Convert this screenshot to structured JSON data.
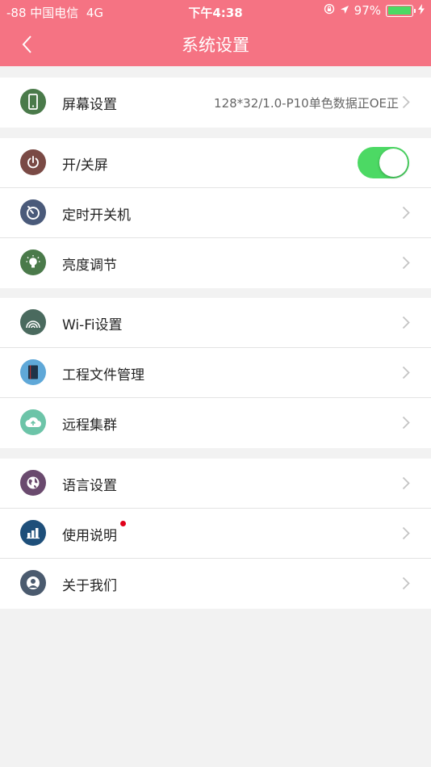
{
  "status_bar": {
    "carrier": "-88 中国电信",
    "network": "4G",
    "time": "下午4:38",
    "battery_percent": "97%",
    "battery_level": 0.97
  },
  "nav": {
    "title": "系统设置"
  },
  "colors": {
    "header": "#f57383",
    "toggle_on": "#4cd964"
  },
  "groups": [
    {
      "rows": [
        {
          "label": "屏幕设置",
          "value": "128*32/1.0-P10单色数据正OE正",
          "icon": "phone-icon",
          "icon_color": "#4a7a4a"
        }
      ]
    },
    {
      "rows": [
        {
          "label": "开/关屏",
          "toggle_on": true,
          "icon": "power-icon",
          "icon_color": "#7a4a45"
        },
        {
          "label": "定时开关机",
          "icon": "timer-icon",
          "icon_color": "#4a5a7a"
        },
        {
          "label": "亮度调节",
          "icon": "bulb-icon",
          "icon_color": "#4a7a4a"
        }
      ]
    },
    {
      "rows": [
        {
          "label": "Wi-Fi设置",
          "icon": "wifi-icon",
          "icon_color": "#4a6a5e"
        },
        {
          "label": "工程文件管理",
          "icon": "notebook-icon",
          "icon_color": "#5fa8d8"
        },
        {
          "label": "远程集群",
          "icon": "cloud-upload-icon",
          "icon_color": "#6cc4a8"
        }
      ]
    },
    {
      "rows": [
        {
          "label": "语言设置",
          "icon": "globe-icon",
          "icon_color": "#6a4a6e"
        },
        {
          "label": "使用说明",
          "has_badge": true,
          "icon": "chart-icon",
          "icon_color": "#1e4f7a"
        },
        {
          "label": "关于我们",
          "icon": "user-icon",
          "icon_color": "#4a5a6e"
        }
      ]
    }
  ]
}
